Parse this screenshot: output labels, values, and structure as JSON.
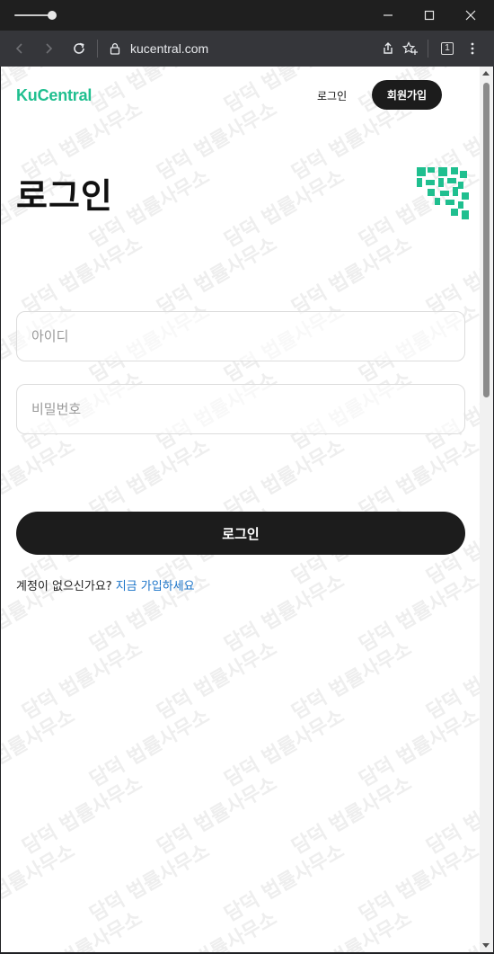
{
  "browser": {
    "url": "kucentral.com",
    "tab_count": "1",
    "icons": {
      "back": "arrow-left-icon",
      "forward": "arrow-right-icon",
      "reload": "reload-icon",
      "lock": "lock-icon",
      "share": "share-icon",
      "bookmark": "star-plus-icon",
      "menu": "more-vertical-icon"
    }
  },
  "header": {
    "logo": "KuCentral",
    "login_link": "로그인",
    "signup_button": "회원가입"
  },
  "main": {
    "title": "로그인",
    "id_placeholder": "아이디",
    "password_placeholder": "비밀번호",
    "login_button": "로그인",
    "no_account_text": "계정이 없으신가요?",
    "signup_link": "지금 가입하세요"
  },
  "watermark": {
    "text": "담덕 법률사무소"
  },
  "colors": {
    "brand": "#1fbf8f",
    "dark": "#1c1c1c",
    "link": "#1a73c8"
  }
}
